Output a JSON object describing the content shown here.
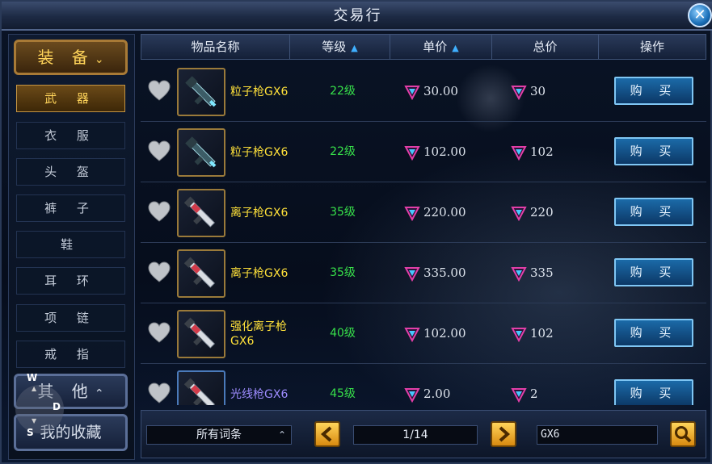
{
  "window": {
    "title": "交易行",
    "close_label": "✕"
  },
  "sidebar": {
    "category_header": "装 备",
    "items": [
      {
        "label": "武 器",
        "active": true
      },
      {
        "label": "衣 服",
        "active": false
      },
      {
        "label": "头 盔",
        "active": false
      },
      {
        "label": "裤 子",
        "active": false
      },
      {
        "label": "鞋",
        "active": false
      },
      {
        "label": "耳 环",
        "active": false
      },
      {
        "label": "项 链",
        "active": false
      },
      {
        "label": "戒 指",
        "active": false
      }
    ],
    "other_label": "其 他",
    "favorites_label": "我的收藏"
  },
  "wasd": {
    "w": "W",
    "d": "D",
    "s": "S"
  },
  "table": {
    "headers": {
      "name": "物品名称",
      "level": "等级",
      "unit_price": "单价",
      "total_price": "总价",
      "action": "操作"
    },
    "rows": [
      {
        "name": "粒子枪GX6",
        "level": "22级",
        "unit_price": "30.00",
        "total": "30",
        "buy": "购 买",
        "weapon": "rifle",
        "name_color": "yellow"
      },
      {
        "name": "粒子枪GX6",
        "level": "22级",
        "unit_price": "102.00",
        "total": "102",
        "buy": "购 买",
        "weapon": "rifle",
        "name_color": "yellow"
      },
      {
        "name": "离子枪GX6",
        "level": "35级",
        "unit_price": "220.00",
        "total": "220",
        "buy": "购 买",
        "weapon": "ion",
        "name_color": "yellow"
      },
      {
        "name": "离子枪GX6",
        "level": "35级",
        "unit_price": "335.00",
        "total": "335",
        "buy": "购 买",
        "weapon": "ion",
        "name_color": "yellow"
      },
      {
        "name": "强化离子枪GX6",
        "level": "40级",
        "unit_price": "102.00",
        "total": "102",
        "buy": "购 买",
        "weapon": "ion",
        "name_color": "yellow"
      },
      {
        "name": "光线枪GX6",
        "level": "45级",
        "unit_price": "2.00",
        "total": "2",
        "buy": "购 买",
        "weapon": "ion",
        "name_color": "purple"
      }
    ]
  },
  "footer": {
    "filter_value": "所有词条",
    "page_indicator": "1/14",
    "search_value": "GX6"
  },
  "colors": {
    "item_name_yellow": "#ffe13a",
    "item_name_purple": "#9e8cff",
    "level_green": "#37e04a",
    "buy_button": "#1b6aa8",
    "category_gold": "#ffd45a"
  },
  "icons": [
    "heart-icon",
    "gem-currency-icon",
    "sort-asc-icon",
    "chevron-down-icon",
    "chevron-up-icon",
    "arrow-left-icon",
    "arrow-right-icon",
    "search-icon",
    "close-icon"
  ]
}
